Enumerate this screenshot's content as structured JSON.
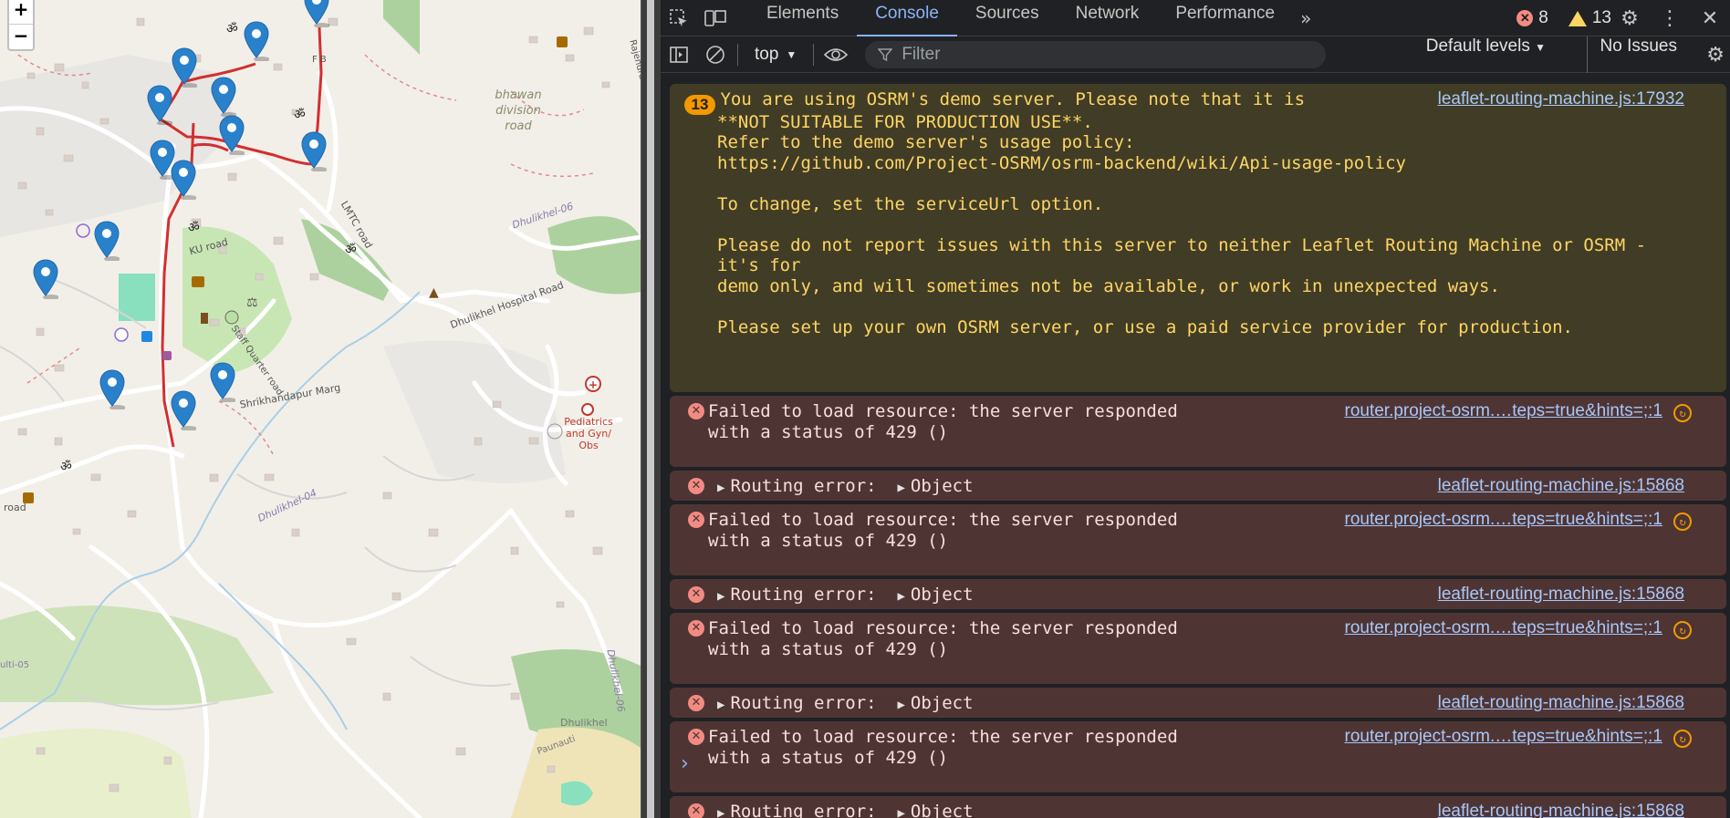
{
  "map": {
    "zoom_in": "+",
    "zoom_out": "−",
    "labels": {
      "bhawan": "bhawan division road",
      "dhulikhel06a": "Dhulikhel-06",
      "hospital_road": "Dhulikhel Hospital Road",
      "ku_road": "KU road",
      "staff_quarter": "Staff Quarter road",
      "shrikhandapur": "Shrikhandapur Marg",
      "lmtc": "LMTC road",
      "dhulikhel04": "Dhulikhel-04",
      "pediatrics": "Pediatrics and Gyn/ Obs",
      "fb": "F B",
      "dhulikhel06b": "Dhulikhel-06",
      "dhulikhel_s": "Dhulikhel",
      "paunauti": "Paunauti",
      "road": "road",
      "rajendra": "Rajendra",
      "ulti05": "ulti-05"
    }
  },
  "devtools": {
    "tabs": [
      "Elements",
      "Console",
      "Sources",
      "Network",
      "Performance"
    ],
    "active_tab": "Console",
    "more": "»",
    "error_count": "8",
    "warning_count": "13",
    "context": "top",
    "filter_placeholder": "Filter",
    "levels": "Default levels",
    "issues": "No Issues",
    "warning": {
      "count": "13",
      "lines": [
        "You are using OSRM's demo server. Please note that it is",
        "**NOT SUITABLE FOR PRODUCTION USE**.",
        "Refer to the demo server's usage policy:",
        "https://github.com/Project-OSRM/osrm-backend/wiki/Api-usage-policy",
        "",
        "To change, set the serviceUrl option.",
        "",
        "Please do not report issues with this server to neither Leaflet Routing Machine or OSRM -",
        "it's for",
        "demo only, and will sometimes not be available, or work in unexpected ways.",
        "",
        "Please set up your own OSRM server, or use a paid service provider for production."
      ],
      "source": "leaflet-routing-machine.js:17932"
    },
    "errors": [
      {
        "type": "net",
        "line1": "Failed to load resource: the server responded",
        "line2": "with a status of 429 ()",
        "source": "router.project-osrm.…teps=true&hints=;:1"
      },
      {
        "type": "route",
        "label": "Routing error:",
        "obj": "Object",
        "source": "leaflet-routing-machine.js:15868"
      },
      {
        "type": "net",
        "line1": "Failed to load resource: the server responded",
        "line2": "with a status of 429 ()",
        "source": "router.project-osrm.…teps=true&hints=;:1"
      },
      {
        "type": "route",
        "label": "Routing error:",
        "obj": "Object",
        "source": "leaflet-routing-machine.js:15868"
      },
      {
        "type": "net",
        "line1": "Failed to load resource: the server responded",
        "line2": "with a status of 429 ()",
        "source": "router.project-osrm.…teps=true&hints=;:1"
      },
      {
        "type": "route",
        "label": "Routing error:",
        "obj": "Object",
        "source": "leaflet-routing-machine.js:15868"
      },
      {
        "type": "net",
        "line1": "Failed to load resource: the server responded",
        "line2": "with a status of 429 ()",
        "source": "router.project-osrm.…teps=true&hints=;:1"
      },
      {
        "type": "route",
        "label": "Routing error:",
        "obj": "Object",
        "source": "leaflet-routing-machine.js:15868"
      }
    ],
    "prompt": "›"
  }
}
